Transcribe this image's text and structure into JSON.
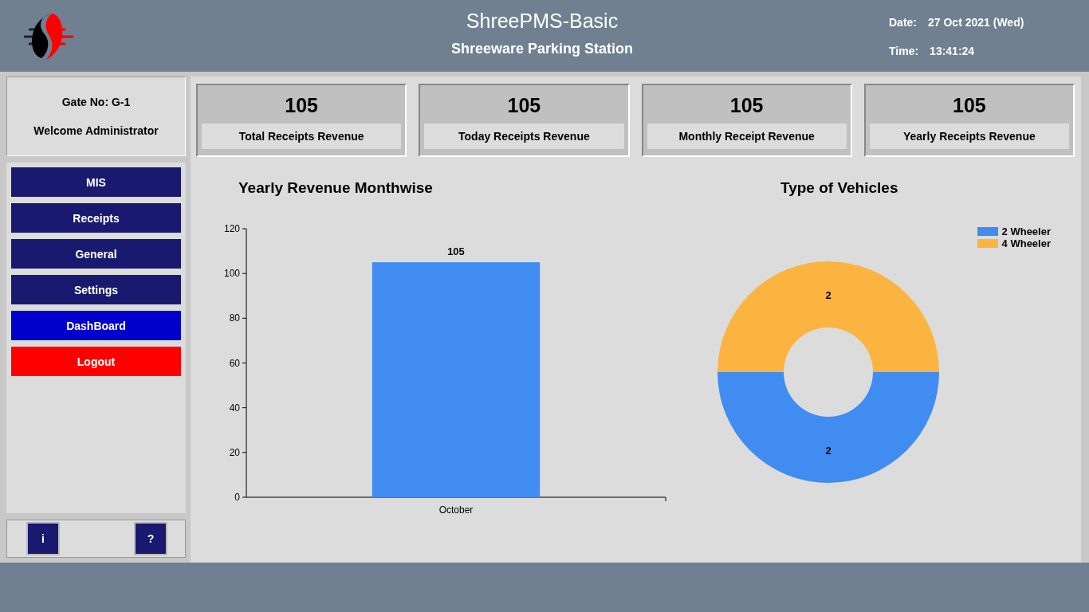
{
  "header": {
    "title": "ShreePMS-Basic",
    "subtitle": "Shreeware Parking Station",
    "date_label": "Date:",
    "date": "27 Oct 2021 (Wed)",
    "time_label": "Time:",
    "time": "13:41:24"
  },
  "user_panel": {
    "gate": "Gate No: G-1",
    "welcome": "Welcome Administrator"
  },
  "menu": [
    {
      "label": "MIS",
      "kind": "nav",
      "selected": false
    },
    {
      "label": "Receipts",
      "kind": "nav",
      "selected": false
    },
    {
      "label": "General",
      "kind": "nav",
      "selected": false
    },
    {
      "label": "Settings",
      "kind": "nav",
      "selected": false
    },
    {
      "label": "DashBoard",
      "kind": "nav",
      "selected": true
    },
    {
      "label": "Logout",
      "kind": "logout",
      "selected": false
    }
  ],
  "footer_buttons": [
    "i",
    "?"
  ],
  "cards": [
    {
      "value": "105",
      "label": "Total Receipts Revenue"
    },
    {
      "value": "105",
      "label": "Today Receipts Revenue"
    },
    {
      "value": "105",
      "label": "Monthly Receipt Revenue"
    },
    {
      "value": "105",
      "label": "Yearly Receipts Revenue"
    }
  ],
  "bar_chart": {
    "chart_data": {
      "type": "bar",
      "title": "Yearly Revenue Monthwise",
      "categories": [
        "October"
      ],
      "series": [
        {
          "color": "#418cf0",
          "values": [
            105
          ]
        }
      ],
      "ylim": [
        0,
        120
      ],
      "yticks": [
        0,
        20,
        40,
        60,
        80,
        100,
        120
      ],
      "data_labels": true
    }
  },
  "donut_chart": {
    "chart_data": {
      "type": "donut",
      "title": "Type of Vehicles",
      "categories": [
        "2 Wheeler",
        "4 Wheeler"
      ],
      "series": [
        {
          "values": [
            2,
            2
          ]
        }
      ],
      "colors": [
        "#418cf0",
        "#fcb441"
      ],
      "legend": true,
      "data_labels": true
    }
  }
}
